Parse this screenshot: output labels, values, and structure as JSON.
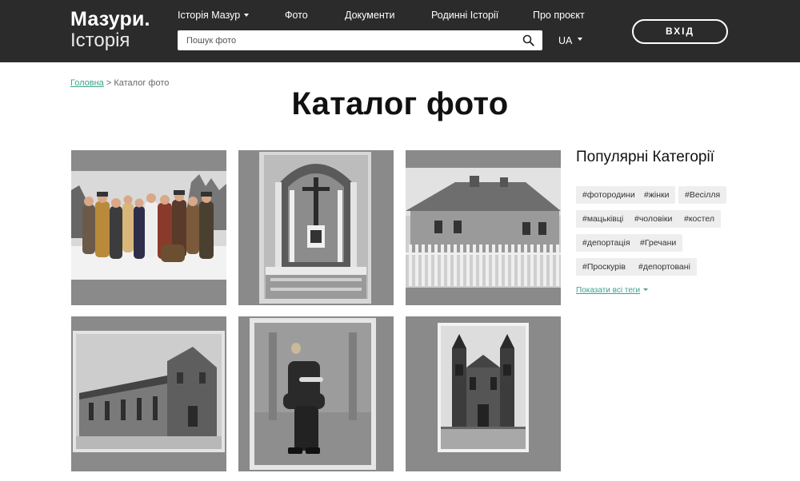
{
  "header": {
    "logo_line1": "Мазури.",
    "logo_line2": "Історія",
    "nav": [
      {
        "label": "Історія Мазур"
      },
      {
        "label": "Фото"
      },
      {
        "label": "Документи"
      },
      {
        "label": "Родинні Історії"
      },
      {
        "label": "Про проєкт"
      }
    ],
    "search_placeholder": "Пошук фото",
    "lang": "UA",
    "login_label": "ВХІД"
  },
  "breadcrumb": {
    "home": "Головна",
    "separator": ">",
    "current": "Каталог фото"
  },
  "page_title": "Каталог фото",
  "photos": [
    {
      "subject": "group-in-snow"
    },
    {
      "subject": "church-altar"
    },
    {
      "subject": "wooden-house"
    },
    {
      "subject": "church-building"
    },
    {
      "subject": "seated-priest"
    },
    {
      "subject": "church-two-towers"
    }
  ],
  "sidebar": {
    "title": "Популярні Категорії",
    "tags": [
      "#фотородини",
      "#жінки",
      "#Весілля",
      "#мацьківці",
      "#чоловіки",
      "#костел",
      "#депортація",
      "#Гречани",
      "#Проскурів",
      "#депортовані"
    ],
    "show_all": "Показати всі теги"
  },
  "colors": {
    "header_bg": "#2b2b2b",
    "accent": "#3aa38a",
    "tag_bg": "#eeeeee",
    "photo_bg": "#8a8a8a"
  }
}
